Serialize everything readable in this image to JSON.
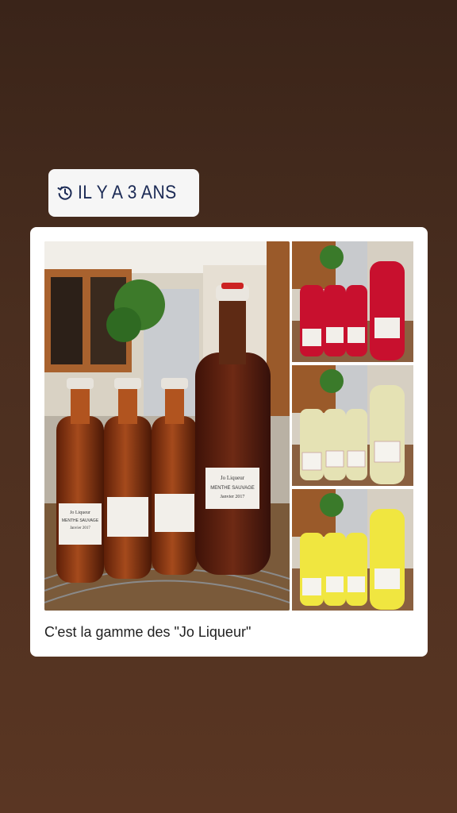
{
  "memory": {
    "label": "IL Y A 3 ANS",
    "icon": "history-clock-icon"
  },
  "post": {
    "caption": "C'est la gamme des \"Jo Liqueur\"",
    "photos": [
      {
        "name": "amber-liqueur-bottles",
        "labels": [
          "Jo Liqueur",
          "MENTHE SAUVAGE",
          "Janvier 2017"
        ]
      },
      {
        "name": "red-liqueur-bottles"
      },
      {
        "name": "pale-liqueur-bottles"
      },
      {
        "name": "yellow-liqueur-bottles"
      }
    ]
  },
  "colors": {
    "background": "#4a2e1f",
    "badge_text": "#1b2a55",
    "amber": "#8a3a16",
    "red": "#c8102e",
    "pale": "#e8e6b8",
    "yellow": "#f2e84a"
  }
}
